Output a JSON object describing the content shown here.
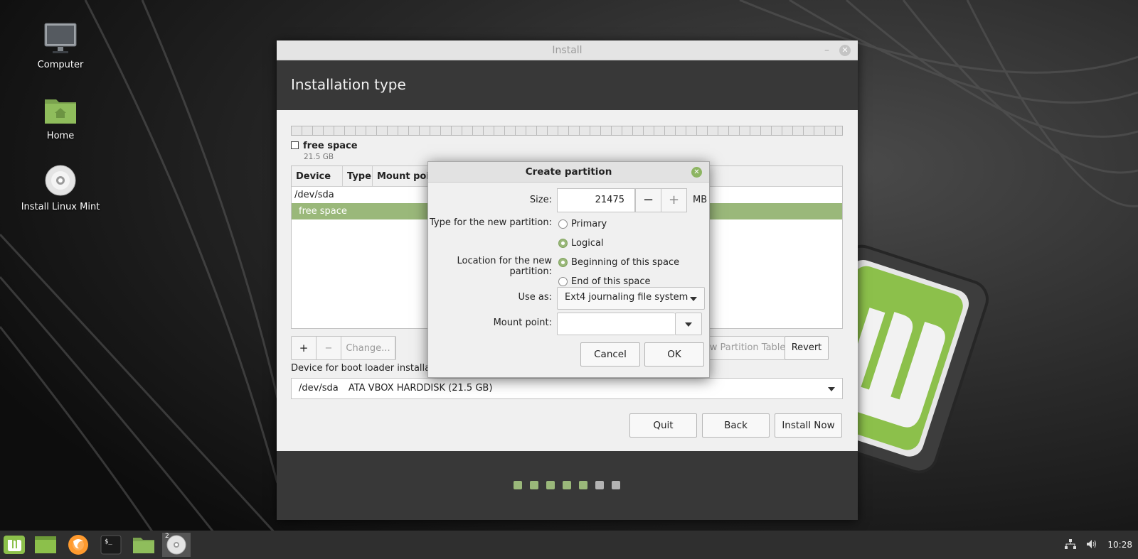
{
  "desktop": {
    "icons": [
      {
        "label": "Computer",
        "icon": "monitor-icon"
      },
      {
        "label": "Home",
        "icon": "home-folder-icon"
      },
      {
        "label": "Install Linux Mint",
        "icon": "disc-icon"
      }
    ]
  },
  "installer": {
    "window_title": "Install",
    "heading": "Installation type",
    "free_space": {
      "name": "free space",
      "size": "21.5 GB"
    },
    "table": {
      "columns": [
        "Device",
        "Type",
        "Mount point"
      ],
      "rows": [
        {
          "device": "/dev/sda",
          "selected": false
        },
        {
          "device": "free space",
          "selected": true
        }
      ]
    },
    "toolbar": {
      "add": "+",
      "remove": "−",
      "change": "Change...",
      "new_table": "New Partition Table...",
      "revert": "Revert"
    },
    "bootloader": {
      "label": "Device for boot loader installation:",
      "device": "/dev/sda",
      "description": "ATA VBOX HARDDISK (21.5 GB)"
    },
    "buttons": {
      "quit": "Quit",
      "back": "Back",
      "install": "Install Now"
    },
    "progress": {
      "completed_steps": 5,
      "total_steps": 7
    }
  },
  "dialog": {
    "title": "Create partition",
    "size_label": "Size:",
    "size_value": "21475",
    "size_unit": "MB",
    "minus": "−",
    "plus": "+",
    "type_label": "Type for the new partition:",
    "type_options": [
      "Primary",
      "Logical"
    ],
    "type_selected": "Logical",
    "location_label": "Location for the new partition:",
    "location_options": [
      "Beginning of this space",
      "End of this space"
    ],
    "location_selected": "Beginning of this space",
    "use_as_label": "Use as:",
    "use_as_value": "Ext4 journaling file system",
    "mount_label": "Mount point:",
    "mount_value": "",
    "cancel": "Cancel",
    "ok": "OK"
  },
  "taskbar": {
    "apps": [
      "mint-menu-icon",
      "show-desktop-icon",
      "firefox-icon",
      "terminal-icon",
      "files-icon",
      "installer-disc-icon"
    ],
    "installer_badge": "2",
    "clock": "10:28"
  },
  "colors": {
    "accent": "#9ab87a",
    "dark_header": "#383838"
  }
}
